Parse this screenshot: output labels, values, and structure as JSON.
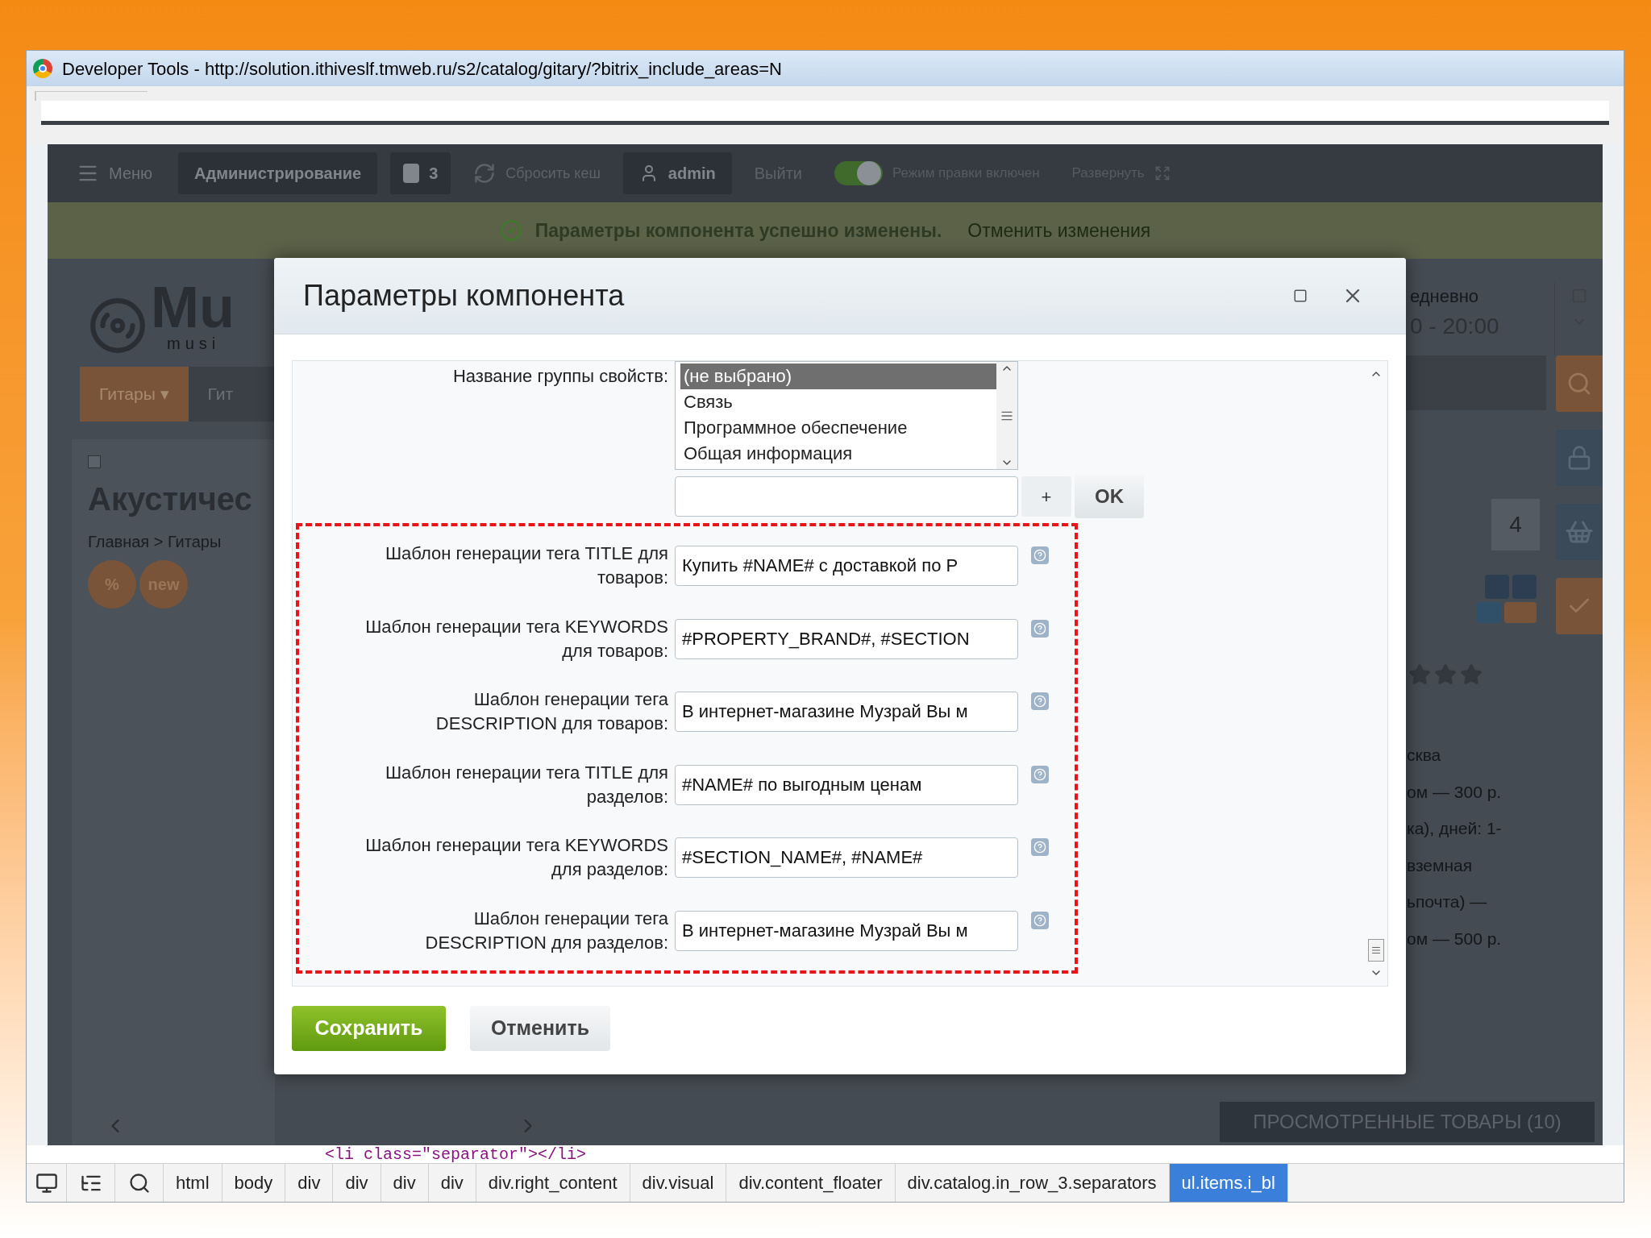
{
  "window": {
    "title": "Developer Tools - http://solution.ithiveslf.tmweb.ru/s2/catalog/gitary/?bitrix_include_areas=N"
  },
  "admin_bar": {
    "items": [
      {
        "kind": "menu",
        "label": "Меню"
      },
      {
        "kind": "button",
        "label": "Администрирование"
      },
      {
        "kind": "badge",
        "label": "3"
      },
      {
        "kind": "refresh",
        "label": "Сбросить кеш"
      },
      {
        "kind": "user",
        "label": "admin"
      },
      {
        "kind": "link",
        "label": "Выйти"
      },
      {
        "kind": "toggle",
        "label": "Режим правки включен",
        "on": true
      },
      {
        "kind": "expand",
        "label": "Развернуть"
      }
    ]
  },
  "notice": {
    "message": "Параметры компонента успешно изменены.",
    "undo": "Отменить изменения"
  },
  "site": {
    "logo": "Mu",
    "logo_sub": "musi",
    "nav": [
      "Гитары ▾",
      "Гит"
    ],
    "heading": "Акустичес",
    "breadcrumb": "Главная > Гитары",
    "badges": [
      "%",
      "new"
    ],
    "hours": [
      "едневно",
      "0 - 20:00"
    ],
    "cart_count": "4",
    "delivery_lines": [
      "сква",
      "ом — 300 р.",
      "ка), дней: 1-",
      "вземная",
      "ьпочта) —",
      "ом — 500 р."
    ],
    "viewed": "ПРОСМОТРЕННЫЕ ТОВАРЫ (10)"
  },
  "dialog": {
    "title": "Параметры компонента",
    "group": {
      "label": "Название группы свойств:",
      "options": [
        {
          "label": "(не выбрано)",
          "selected": true
        },
        {
          "label": "Связь",
          "selected": false
        },
        {
          "label": "Программное обеспечение",
          "selected": false
        },
        {
          "label": "Общая информация",
          "selected": false
        }
      ]
    },
    "new_group": {
      "add": "+",
      "ok": "OK"
    },
    "fields": [
      {
        "label": "Шаблон генерации тега TITLE для\nтоваров:",
        "value": "Купить #NAME# с доставкой по Р"
      },
      {
        "label": "Шаблон генерации тега KEYWORDS\nдля товаров:",
        "value": "#PROPERTY_BRAND#, #SECTION"
      },
      {
        "label": "Шаблон генерации тега\nDESCRIPTION для товаров:",
        "value": "В интернет-магазине Музрай Вы м"
      },
      {
        "label": "Шаблон генерации тега TITLE для\nразделов:",
        "value": "#NAME# по выгодным ценам"
      },
      {
        "label": "Шаблон генерации тега KEYWORDS\nдля разделов:",
        "value": "#SECTION_NAME#, #NAME#"
      },
      {
        "label": "Шаблон генерации тега\nDESCRIPTION для разделов:",
        "value": "В интернет-магазине Музрай Вы м"
      }
    ],
    "buttons": {
      "save": "Сохранить",
      "cancel": "Отменить"
    }
  },
  "devtools": {
    "source_line": "<li class=\"separator\"></li>",
    "breadcrumbs": [
      {
        "label": "html",
        "selected": false
      },
      {
        "label": "body",
        "selected": false
      },
      {
        "label": "div",
        "selected": false
      },
      {
        "label": "div",
        "selected": false
      },
      {
        "label": "div",
        "selected": false
      },
      {
        "label": "div",
        "selected": false
      },
      {
        "label": "div.right_content",
        "selected": false
      },
      {
        "label": "div.visual",
        "selected": false
      },
      {
        "label": "div.content_floater",
        "selected": false
      },
      {
        "label": "div.catalog.in_row_3.separators",
        "selected": false
      },
      {
        "label": "ul.items.i_bl",
        "selected": true
      }
    ]
  }
}
